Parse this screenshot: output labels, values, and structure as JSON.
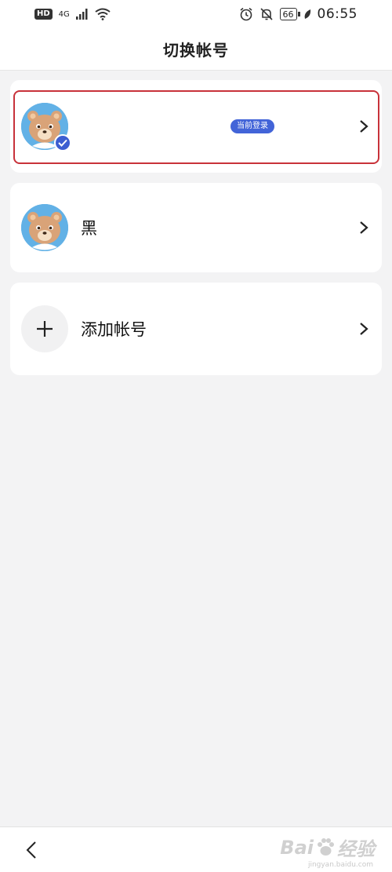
{
  "status_bar": {
    "hd": "HD",
    "network": "4G",
    "battery": "66",
    "time": "06:55"
  },
  "header": {
    "title": "切换帐号"
  },
  "accounts": [
    {
      "name": "",
      "badge": "当前登录",
      "current": true
    },
    {
      "name": "黑",
      "current": false
    }
  ],
  "add_account": {
    "label": "添加帐号"
  },
  "watermark": {
    "brand_left": "Bai",
    "brand_right": "经验",
    "sub": "jingyan.baidu.com"
  },
  "colors": {
    "accent": "#4264d8",
    "highlight": "#c8323a",
    "avatar_bg": "#62b1e6"
  },
  "icons": [
    "alarm-icon",
    "mute-icon",
    "wifi-icon",
    "chevron-right-icon",
    "plus-icon",
    "back-icon",
    "check-icon"
  ]
}
